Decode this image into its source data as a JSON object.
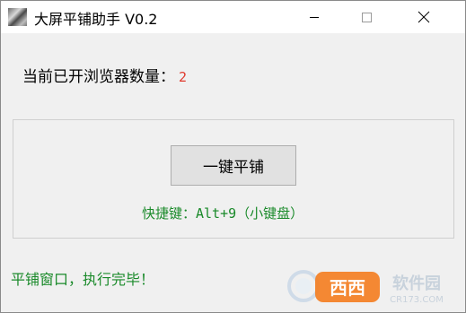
{
  "window": {
    "title": "大屏平铺助手 V0.2"
  },
  "status": {
    "label": "当前已开浏览器数量：",
    "count": "2"
  },
  "action": {
    "button_label": "一键平铺",
    "hotkey_hint": "快捷键：Alt+9（小键盘）"
  },
  "result": {
    "message": "平铺窗口，执行完毕！"
  },
  "watermark": {
    "text": "西西软件园",
    "url": "CR173.COM"
  },
  "colors": {
    "count": "#e03a2e",
    "hint": "#1a8a2a",
    "result": "#1a8a2a"
  }
}
